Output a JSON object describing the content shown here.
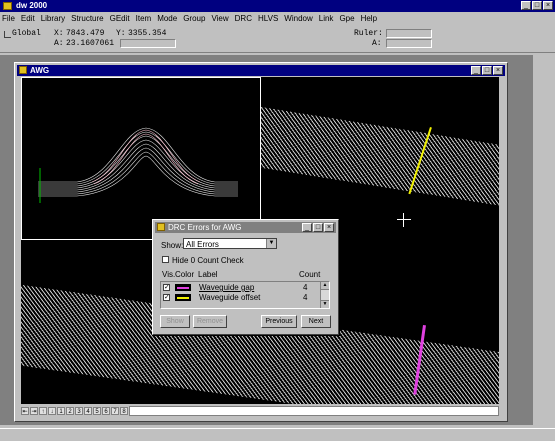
{
  "app": {
    "title": "dw 2000"
  },
  "window_buttons": {
    "minimize": "_",
    "maximize": "□",
    "close": "×"
  },
  "menu": [
    "File",
    "Edit",
    "Library",
    "Structure",
    "GEdit",
    "Item",
    "Mode",
    "Group",
    "View",
    "DRC",
    "HLVS",
    "Window",
    "Link",
    "Gpe",
    "Help"
  ],
  "coords": {
    "global_label": "Global",
    "x_label": "X:",
    "x_value": "7843.479",
    "y_label": "Y:",
    "y_value": "3355.354",
    "a_label": "A:",
    "a_value": "23.1607061",
    "ruler_label": "Ruler:",
    "ruler_a_label": "A:"
  },
  "awg_window": {
    "title": "AWG"
  },
  "drc_dialog": {
    "title": "DRC Errors for AWG",
    "show_label": "Show:",
    "show_value": "All Errors",
    "hide_label": "Hide 0 Count Check",
    "columns": {
      "vis": "Vis.",
      "color": "Color",
      "label": "Label",
      "count": "Count"
    },
    "rows": [
      {
        "label": "Waveguide gap",
        "count": "4",
        "color": "#e040e0"
      },
      {
        "label": "Waveguide offset",
        "count": "4",
        "color": "#f0f000"
      }
    ],
    "buttons": {
      "show": "Show",
      "remove": "Remove",
      "previous": "Previous",
      "next": "Next"
    }
  },
  "layer_tabs": [
    "⇤",
    "⇥",
    "↑",
    "↓",
    "1",
    "2",
    "3",
    "4",
    "5",
    "6",
    "7",
    "8"
  ]
}
